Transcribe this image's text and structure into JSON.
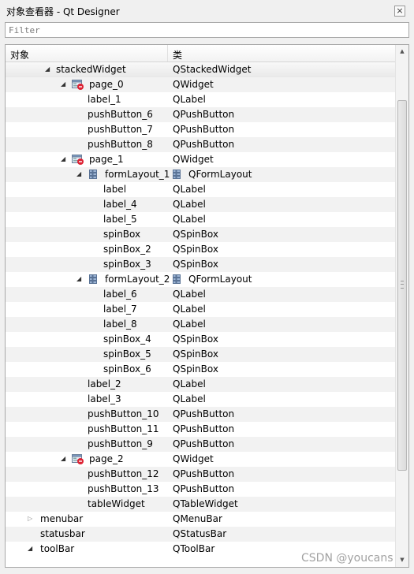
{
  "window": {
    "title": "对象查看器 - Qt Designer",
    "close_glyph": "×"
  },
  "filter": {
    "placeholder": "Filter",
    "value": ""
  },
  "header": {
    "object": "对象",
    "class": "类"
  },
  "rows": [
    {
      "name": "stackedWidget",
      "class": "QStackedWidget",
      "level": 0,
      "expander": "expanded",
      "icon": "",
      "class_icon": "",
      "selected": true
    },
    {
      "name": "page_0",
      "class": "QWidget",
      "level": 1,
      "expander": "expanded",
      "icon": "page-widget-icon",
      "class_icon": ""
    },
    {
      "name": "label_1",
      "class": "QLabel",
      "level": 2,
      "expander": "",
      "icon": "",
      "class_icon": ""
    },
    {
      "name": "pushButton_6",
      "class": "QPushButton",
      "level": 2,
      "expander": "",
      "icon": "",
      "class_icon": ""
    },
    {
      "name": "pushButton_7",
      "class": "QPushButton",
      "level": 2,
      "expander": "",
      "icon": "",
      "class_icon": ""
    },
    {
      "name": "pushButton_8",
      "class": "QPushButton",
      "level": 2,
      "expander": "",
      "icon": "",
      "class_icon": ""
    },
    {
      "name": "page_1",
      "class": "QWidget",
      "level": 1,
      "expander": "expanded",
      "icon": "page-widget-icon",
      "class_icon": ""
    },
    {
      "name": "formLayout_1",
      "class": "QFormLayout",
      "level": 2,
      "expander": "expanded",
      "icon": "form-layout-icon",
      "class_icon": "form-layout-icon"
    },
    {
      "name": "label",
      "class": "QLabel",
      "level": 3,
      "expander": "",
      "icon": "",
      "class_icon": ""
    },
    {
      "name": "label_4",
      "class": "QLabel",
      "level": 3,
      "expander": "",
      "icon": "",
      "class_icon": ""
    },
    {
      "name": "label_5",
      "class": "QLabel",
      "level": 3,
      "expander": "",
      "icon": "",
      "class_icon": ""
    },
    {
      "name": "spinBox",
      "class": "QSpinBox",
      "level": 3,
      "expander": "",
      "icon": "",
      "class_icon": ""
    },
    {
      "name": "spinBox_2",
      "class": "QSpinBox",
      "level": 3,
      "expander": "",
      "icon": "",
      "class_icon": ""
    },
    {
      "name": "spinBox_3",
      "class": "QSpinBox",
      "level": 3,
      "expander": "",
      "icon": "",
      "class_icon": ""
    },
    {
      "name": "formLayout_2",
      "class": "QFormLayout",
      "level": 2,
      "expander": "expanded",
      "icon": "form-layout-icon",
      "class_icon": "form-layout-icon"
    },
    {
      "name": "label_6",
      "class": "QLabel",
      "level": 3,
      "expander": "",
      "icon": "",
      "class_icon": ""
    },
    {
      "name": "label_7",
      "class": "QLabel",
      "level": 3,
      "expander": "",
      "icon": "",
      "class_icon": ""
    },
    {
      "name": "label_8",
      "class": "QLabel",
      "level": 3,
      "expander": "",
      "icon": "",
      "class_icon": ""
    },
    {
      "name": "spinBox_4",
      "class": "QSpinBox",
      "level": 3,
      "expander": "",
      "icon": "",
      "class_icon": ""
    },
    {
      "name": "spinBox_5",
      "class": "QSpinBox",
      "level": 3,
      "expander": "",
      "icon": "",
      "class_icon": ""
    },
    {
      "name": "spinBox_6",
      "class": "QSpinBox",
      "level": 3,
      "expander": "",
      "icon": "",
      "class_icon": ""
    },
    {
      "name": "label_2",
      "class": "QLabel",
      "level": 2,
      "expander": "",
      "icon": "",
      "class_icon": ""
    },
    {
      "name": "label_3",
      "class": "QLabel",
      "level": 2,
      "expander": "",
      "icon": "",
      "class_icon": ""
    },
    {
      "name": "pushButton_10",
      "class": "QPushButton",
      "level": 2,
      "expander": "",
      "icon": "",
      "class_icon": ""
    },
    {
      "name": "pushButton_11",
      "class": "QPushButton",
      "level": 2,
      "expander": "",
      "icon": "",
      "class_icon": ""
    },
    {
      "name": "pushButton_9",
      "class": "QPushButton",
      "level": 2,
      "expander": "",
      "icon": "",
      "class_icon": ""
    },
    {
      "name": "page_2",
      "class": "QWidget",
      "level": 1,
      "expander": "expanded",
      "icon": "page-widget-icon",
      "class_icon": ""
    },
    {
      "name": "pushButton_12",
      "class": "QPushButton",
      "level": 2,
      "expander": "",
      "icon": "",
      "class_icon": ""
    },
    {
      "name": "pushButton_13",
      "class": "QPushButton",
      "level": 2,
      "expander": "",
      "icon": "",
      "class_icon": ""
    },
    {
      "name": "tableWidget",
      "class": "QTableWidget",
      "level": 2,
      "expander": "",
      "icon": "",
      "class_icon": ""
    },
    {
      "name": "menubar",
      "class": "QMenuBar",
      "level": -1,
      "expander": "collapsed",
      "icon": "",
      "class_icon": ""
    },
    {
      "name": "statusbar",
      "class": "QStatusBar",
      "level": -1,
      "expander": "",
      "icon": "",
      "class_icon": ""
    },
    {
      "name": "toolBar",
      "class": "QToolBar",
      "level": -1,
      "expander": "expanded",
      "icon": "",
      "class_icon": ""
    }
  ],
  "scrollbar": {
    "up_icon": "scroll-up-arrow-icon",
    "down_icon": "scroll-down-arrow-icon"
  },
  "watermark": "CSDN @youcans"
}
